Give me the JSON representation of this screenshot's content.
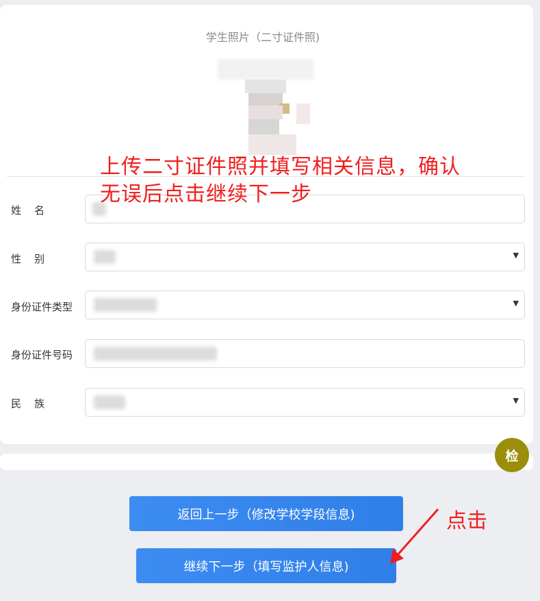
{
  "photo_section": {
    "title": "学生照片（二寸证件照)"
  },
  "annotation": {
    "line1": "上传二寸证件照并填写相关信息，确认",
    "line2": "无误后点击继续下一步"
  },
  "form": {
    "name_label": "姓    名",
    "gender_label": "性    别",
    "id_type_label": "身份证件类型",
    "id_number_label": "身份证件号码",
    "ethnicity_label": "民    族"
  },
  "floating": {
    "check_label": "检"
  },
  "buttons": {
    "back_label": "返回上一步（修改学校学段信息)",
    "next_label": "继续下一步（填写监护人信息)"
  },
  "hint": {
    "click_label": "点击"
  },
  "colors": {
    "primary_button": "#2f7fe8",
    "annotation_red": "#f01e1e",
    "badge_olive": "#9a8e0a"
  }
}
